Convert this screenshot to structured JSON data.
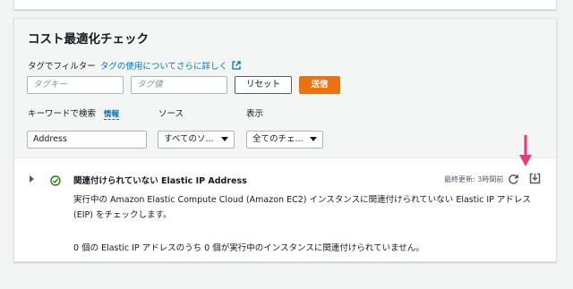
{
  "section": {
    "title": "コスト最適化チェック",
    "filter_label": "タグでフィルター",
    "filter_link": "タグの使用についてさらに詳しく",
    "tag_key_placeholder": "タグキー",
    "tag_value_placeholder": "タグ値",
    "reset_label": "リセット",
    "send_label": "送信",
    "keyword_label": "キーワードで検索",
    "info_label": "情報",
    "keyword_value": "Address",
    "source_label": "ソース",
    "source_value": "すべてのソ...",
    "display_label": "表示",
    "display_value": "全てのチェ..."
  },
  "check": {
    "title": "関連付けられていない Elastic IP Address",
    "updated": "最終更新: 3時間前",
    "description": "実行中の Amazon Elastic Compute Cloud (Amazon EC2) インスタンスに関連付けられていない Elastic IP アドレス (EIP) をチェックします。",
    "summary": "0 個の Elastic IP アドレスのうち 0 個が実行中のインスタンスに関連付けられていません。",
    "status_icon": "check-circle-icon"
  },
  "colors": {
    "accent": "#ec7211",
    "link": "#0073bb",
    "ok": "#1d8102",
    "annotation_arrow": "#f0377a"
  }
}
